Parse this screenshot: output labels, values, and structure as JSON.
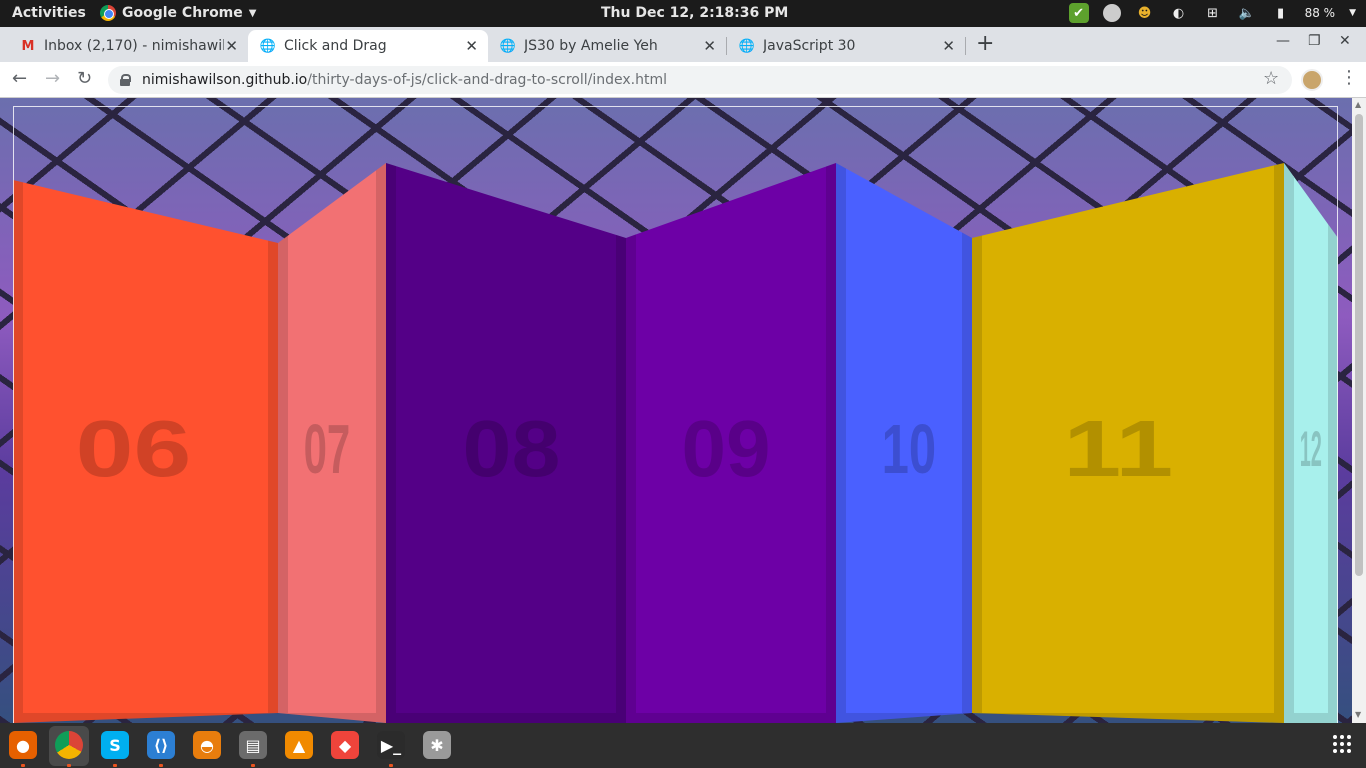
{
  "system_bar": {
    "activities": "Activities",
    "app_name": "Google Chrome",
    "clock": "Thu Dec 12,  2:18:36 PM",
    "battery": "88 %"
  },
  "tabs": [
    {
      "title": "Inbox (2,170) - nimishawil",
      "icon": "gmail-icon",
      "active": false
    },
    {
      "title": "Click and Drag",
      "icon": "globe-icon",
      "active": true
    },
    {
      "title": "JS30 by Amelie Yeh",
      "icon": "globe-icon",
      "active": false
    },
    {
      "title": "JavaScript 30",
      "icon": "globe-icon",
      "active": false
    }
  ],
  "address": {
    "host": "nimishawilson.github.io",
    "path": "/thirty-days-of-js/click-and-drag-to-scroll/index.html"
  },
  "items": [
    {
      "label": "06",
      "color": "#ff512f"
    },
    {
      "label": "07",
      "color": "#f27173"
    },
    {
      "label": "08",
      "color": "#540087"
    },
    {
      "label": "09",
      "color": "#6d00a6"
    },
    {
      "label": "10",
      "color": "#4a60ff"
    },
    {
      "label": "11",
      "color": "#d9b000"
    },
    {
      "label": "12",
      "color": "#a8f0ec"
    }
  ],
  "dock": [
    "firefox-icon",
    "chrome-icon",
    "skype-icon",
    "vscode-icon",
    "blender-icon",
    "files-icon",
    "vlc-icon",
    "anydesk-icon",
    "terminal-icon",
    "settings-icon"
  ]
}
